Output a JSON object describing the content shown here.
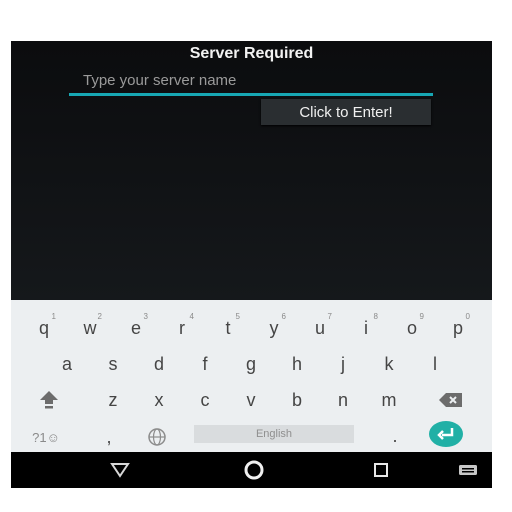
{
  "app": {
    "title": "Server Required",
    "server_input": {
      "placeholder": "Type your server name",
      "value": ""
    },
    "enter_button_label": "Click to Enter!"
  },
  "keyboard": {
    "row1": [
      "q",
      "w",
      "e",
      "r",
      "t",
      "y",
      "u",
      "i",
      "o",
      "p"
    ],
    "row1_digits": [
      "1",
      "2",
      "3",
      "4",
      "5",
      "6",
      "7",
      "8",
      "9",
      "0"
    ],
    "row2": [
      "a",
      "s",
      "d",
      "f",
      "g",
      "h",
      "j",
      "k",
      "l"
    ],
    "row3": [
      "z",
      "x",
      "c",
      "v",
      "b",
      "n",
      "m"
    ],
    "symbols_label": "?1☺",
    "comma": ",",
    "space_label": "English",
    "period": ".",
    "icons": {
      "shift": "shift-icon",
      "backspace": "backspace-icon",
      "globe": "globe-icon",
      "enter": "enter-icon"
    },
    "accent_color": "#21b0a6"
  },
  "navbar": {
    "icons": [
      "back-icon",
      "home-icon",
      "recents-icon",
      "keyboard-icon"
    ]
  },
  "colors": {
    "app_background": "#111315",
    "input_underline": "#17a7b4",
    "keyboard_background": "#eceff1"
  }
}
